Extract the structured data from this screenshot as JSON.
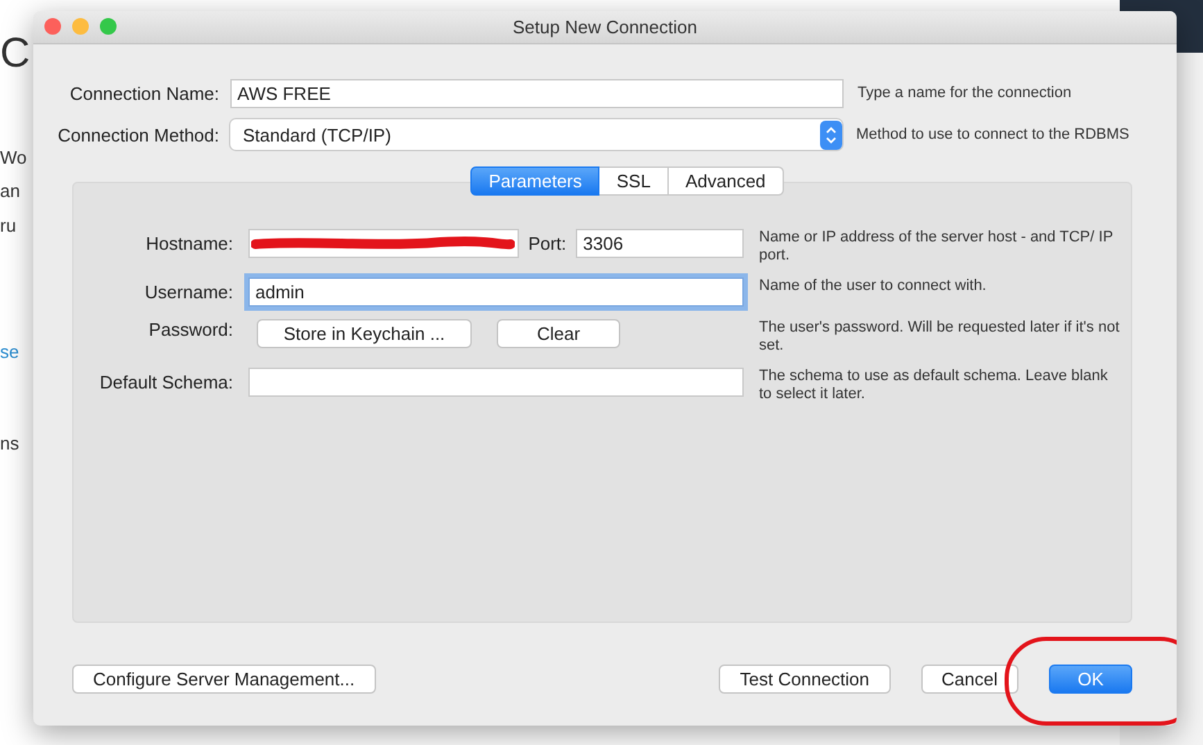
{
  "backdrop": {
    "fragments": [
      {
        "text": "C",
        "kind": "heading"
      },
      {
        "text": "Wo",
        "kind": "text"
      },
      {
        "text": "an",
        "kind": "text"
      },
      {
        "text": "ru",
        "kind": "text"
      },
      {
        "text": "se",
        "kind": "link"
      },
      {
        "text": "ns",
        "kind": "text"
      }
    ]
  },
  "dialog": {
    "title": "Setup New Connection",
    "connection_name": {
      "label": "Connection Name:",
      "value": "AWS FREE",
      "hint": "Type a name for the connection"
    },
    "connection_method": {
      "label": "Connection Method:",
      "value": "Standard (TCP/IP)",
      "hint": "Method to use to connect to the RDBMS"
    },
    "tabs": [
      {
        "label": "Parameters",
        "selected": true
      },
      {
        "label": "SSL",
        "selected": false
      },
      {
        "label": "Advanced",
        "selected": false
      }
    ],
    "fields": [
      {
        "kind": "host",
        "label": "Hostname:",
        "redacted": true,
        "port_label": "Port:",
        "port_value": "3306",
        "hint": "Name or IP address of the server host - and TCP/ IP port."
      },
      {
        "kind": "text",
        "label": "Username:",
        "value": "admin",
        "focused": true,
        "hint": "Name of the user to connect with."
      },
      {
        "kind": "password",
        "label": "Password:",
        "buttons": [
          "Store in Keychain ...",
          "Clear"
        ],
        "hint": "The user's password. Will be requested later if it's not set."
      },
      {
        "kind": "text",
        "label": "Default Schema:",
        "focused": false,
        "hint": "The schema to use as default schema. Leave blank to select it later."
      }
    ],
    "buttons": [
      {
        "label": "Configure Server Management...",
        "primary": false,
        "circled": false
      },
      {
        "label": "Test Connection",
        "primary": false,
        "circled": false
      },
      {
        "label": "Cancel",
        "primary": false,
        "circled": false
      },
      {
        "label": "OK",
        "primary": true,
        "circled": true
      }
    ]
  }
}
